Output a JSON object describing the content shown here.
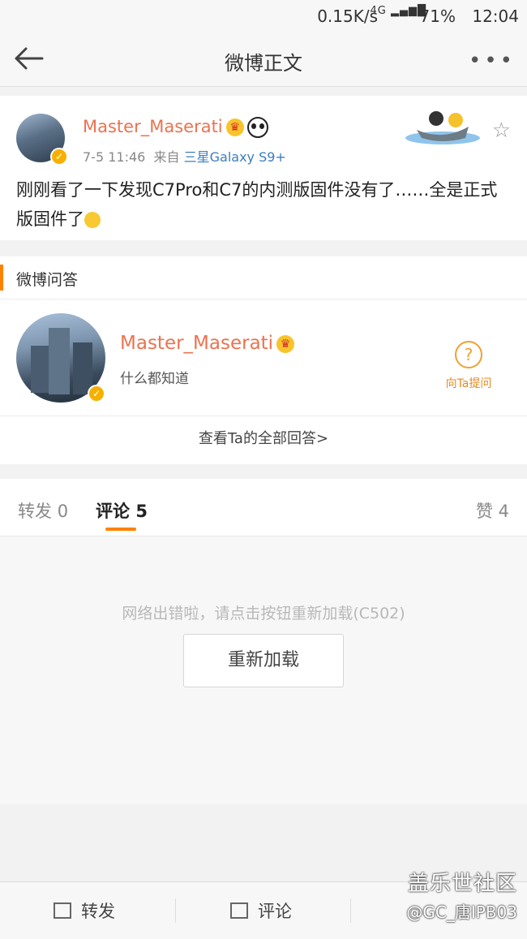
{
  "status_bar": {
    "network_speed": "0.15K/s",
    "signal": "4G",
    "battery": "71%",
    "time": "12:04"
  },
  "nav": {
    "title": "微博正文"
  },
  "post": {
    "username": "Master_Maserati",
    "time": "7-5 11:46",
    "source_prefix": "来自",
    "source": "三星Galaxy S9+",
    "text": "刚刚看了一下发现C7Pro和C7的内测版固件没有了……全是正式版固件了"
  },
  "qa": {
    "section_label": "微博问答",
    "username": "Master_Maserati",
    "bio": "什么都知道",
    "ask_label": "向Ta提问",
    "view_all": "查看Ta的全部回答>"
  },
  "tabs": {
    "repost_label": "转发",
    "repost_count": "0",
    "comment_label": "评论",
    "comment_count": "5",
    "like_label": "赞",
    "like_count": "4"
  },
  "error": {
    "message": "网络出错啦，请点击按钮重新加载(C502)",
    "reload_label": "重新加载"
  },
  "toolbar": {
    "repost": "转发",
    "comment": "评论"
  },
  "watermark": {
    "line1": "盖乐世社区",
    "line2": "@GC_唐IPB03"
  },
  "colors": {
    "accent": "#ff8200",
    "username": "#eb7350",
    "link": "#3b7dc0"
  }
}
